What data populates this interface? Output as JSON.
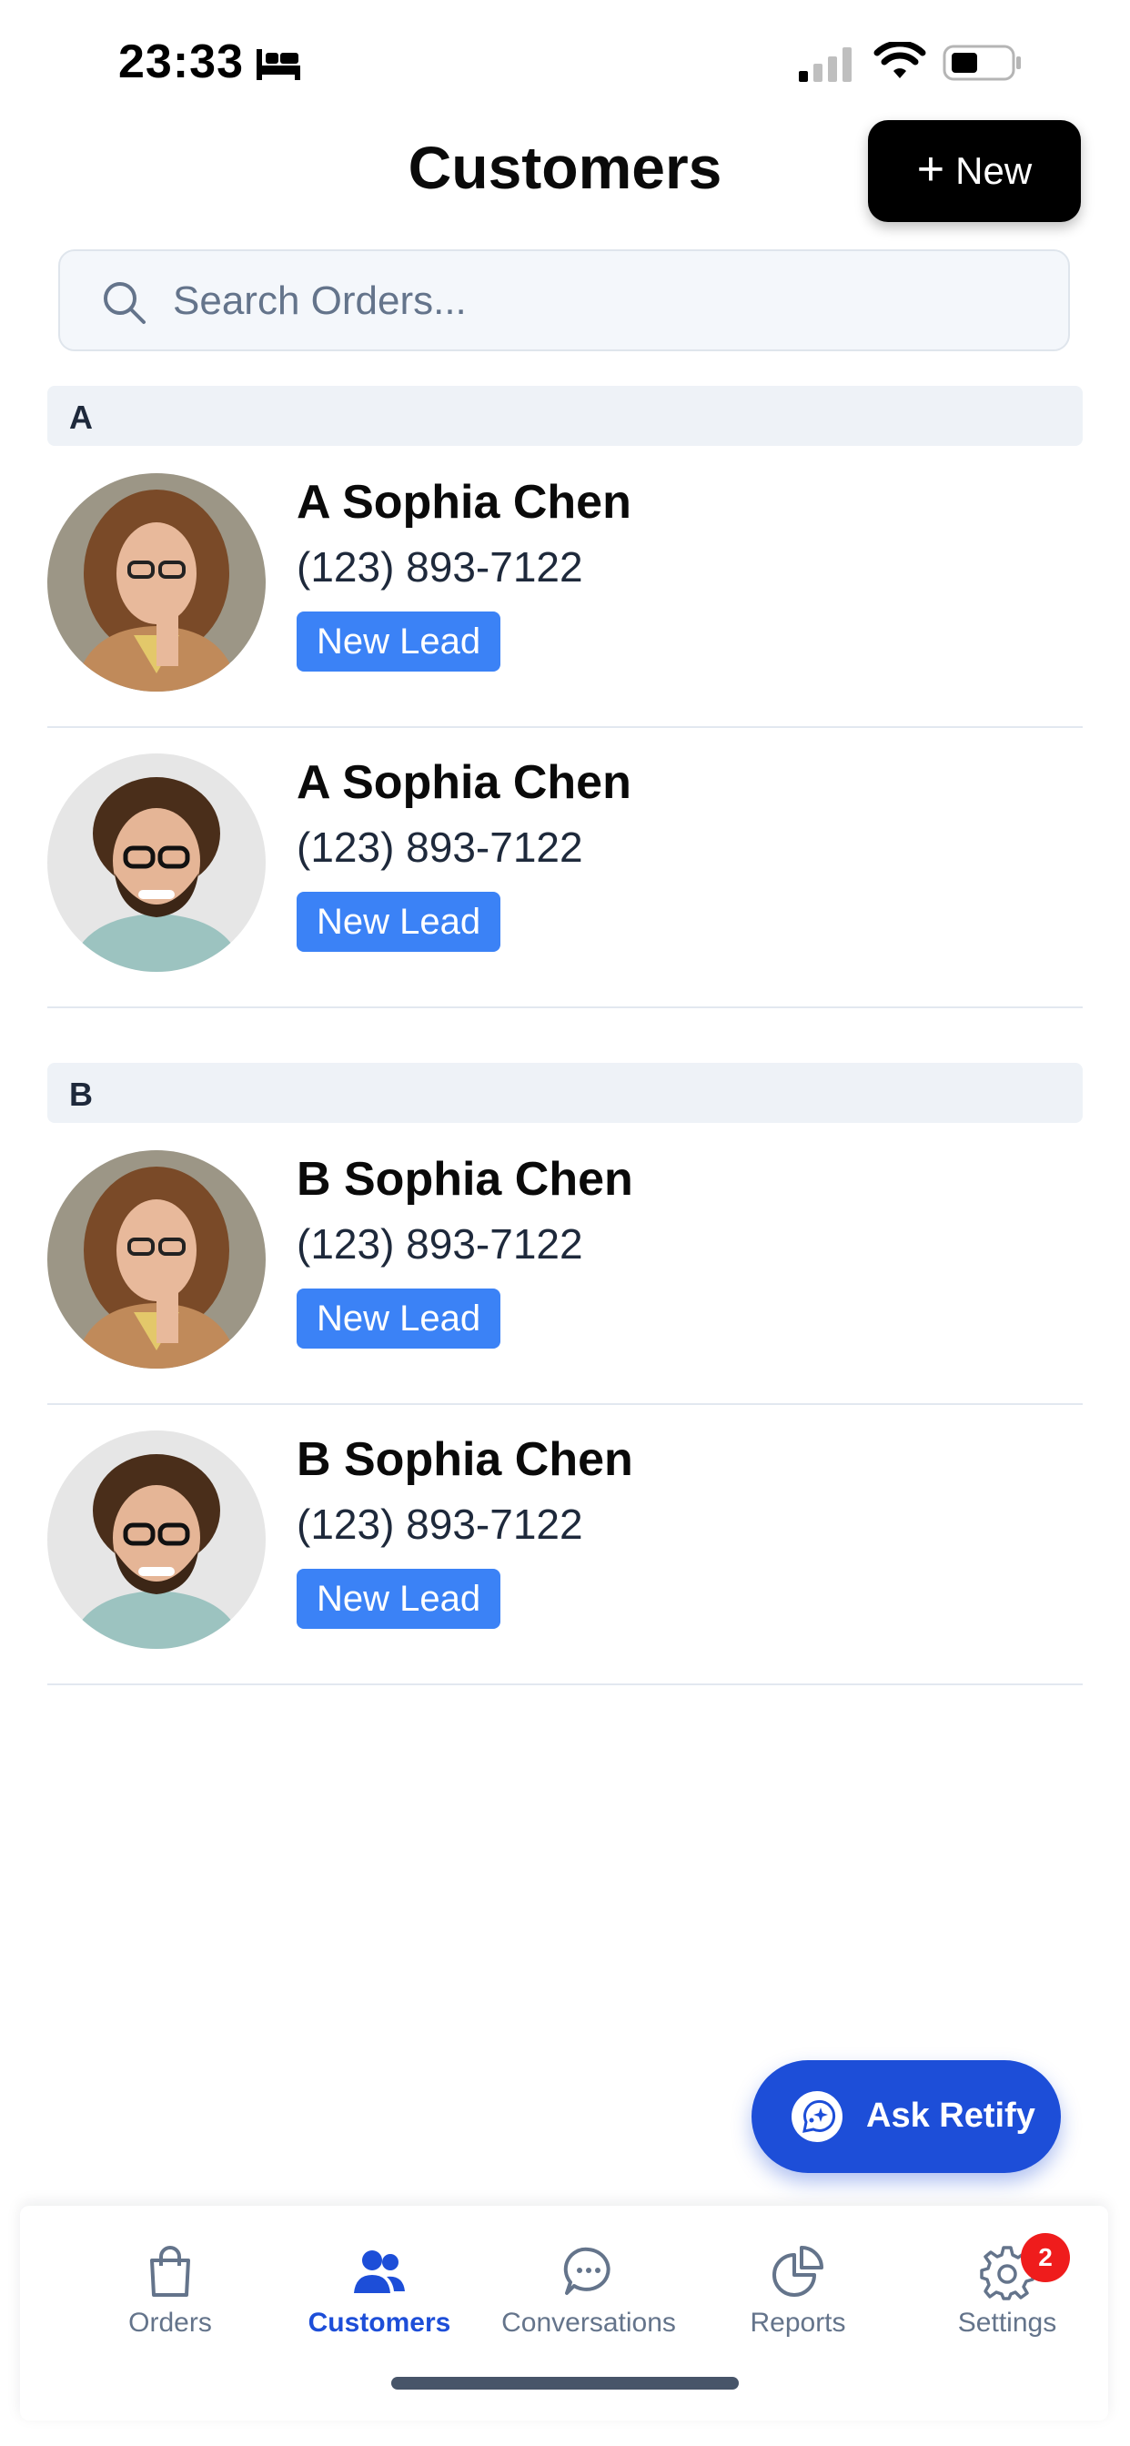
{
  "status_bar": {
    "time": "23:33"
  },
  "header": {
    "title": "Customers",
    "new_label": "New"
  },
  "search": {
    "placeholder": "Search Orders..."
  },
  "sections": [
    {
      "letter": "A",
      "customers": [
        {
          "name": "A Sophia Chen",
          "phone": "(123) 893-7122",
          "badge": "New Lead",
          "avatar": "woman-avatar"
        },
        {
          "name": "A Sophia Chen",
          "phone": "(123) 893-7122",
          "badge": "New Lead",
          "avatar": "man-avatar"
        }
      ]
    },
    {
      "letter": "B",
      "customers": [
        {
          "name": "B Sophia Chen",
          "phone": "(123) 893-7122",
          "badge": "New Lead",
          "avatar": "woman-avatar"
        },
        {
          "name": "B Sophia Chen",
          "phone": "(123) 893-7122",
          "badge": "New Lead",
          "avatar": "man-avatar"
        }
      ]
    }
  ],
  "ask_button": {
    "label": "Ask Retify"
  },
  "tab_bar": {
    "items": [
      {
        "label": "Orders",
        "icon": "bag-icon",
        "active": false
      },
      {
        "label": "Customers",
        "icon": "users-icon",
        "active": true
      },
      {
        "label": "Conversations",
        "icon": "chat-icon",
        "active": false
      },
      {
        "label": "Reports",
        "icon": "pie-chart-icon",
        "active": false
      },
      {
        "label": "Settings",
        "icon": "gear-icon",
        "active": false,
        "badge": "2"
      }
    ]
  },
  "colors": {
    "accent": "#1d4ed8",
    "badge": "#3b82f6",
    "notification": "#ef1c1c"
  }
}
